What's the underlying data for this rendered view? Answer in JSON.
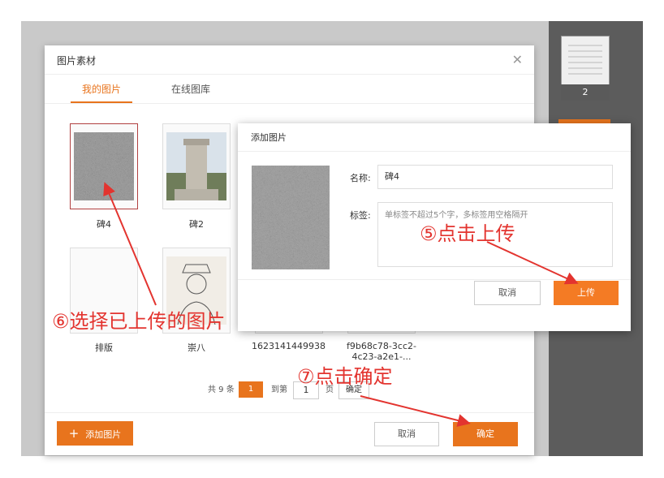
{
  "side_thumb": {
    "page_number": "2"
  },
  "modal": {
    "title": "图片素材",
    "tabs": [
      {
        "label": "我的图片",
        "active": true
      },
      {
        "label": "在线图库",
        "active": false
      }
    ],
    "cards": [
      {
        "label": "碑4",
        "selected": true
      },
      {
        "label": "碑2",
        "selected": false
      },
      {
        "label": "排版",
        "selected": false
      },
      {
        "label": "崇八",
        "selected": false
      },
      {
        "label": "16231414499381",
        "selected": false
      },
      {
        "label": "f9b68c78-3cc2-4c23-a2e1-...",
        "selected": false
      }
    ],
    "pager": {
      "total": "共 9 条",
      "current_page": "1",
      "goto_label": "到第",
      "goto_value": "1",
      "page_unit": "页",
      "confirm": "确定"
    },
    "add_button": "添加图片",
    "cancel_button": "取消",
    "ok_button": "确定"
  },
  "dialog": {
    "title": "添加图片",
    "name_label": "名称:",
    "name_value": "碑4",
    "tags_label": "标签:",
    "tags_placeholder": "单标签不超过5个字，多标签用空格隔开",
    "cancel_button": "取消",
    "upload_button": "上传"
  },
  "annotations": {
    "step5": "⑤点击上传",
    "step6": "⑥选择已上传的图片",
    "step7": "⑦点击确定"
  },
  "colors": {
    "accent": "#e8741d",
    "annotation": "#e3342f"
  }
}
